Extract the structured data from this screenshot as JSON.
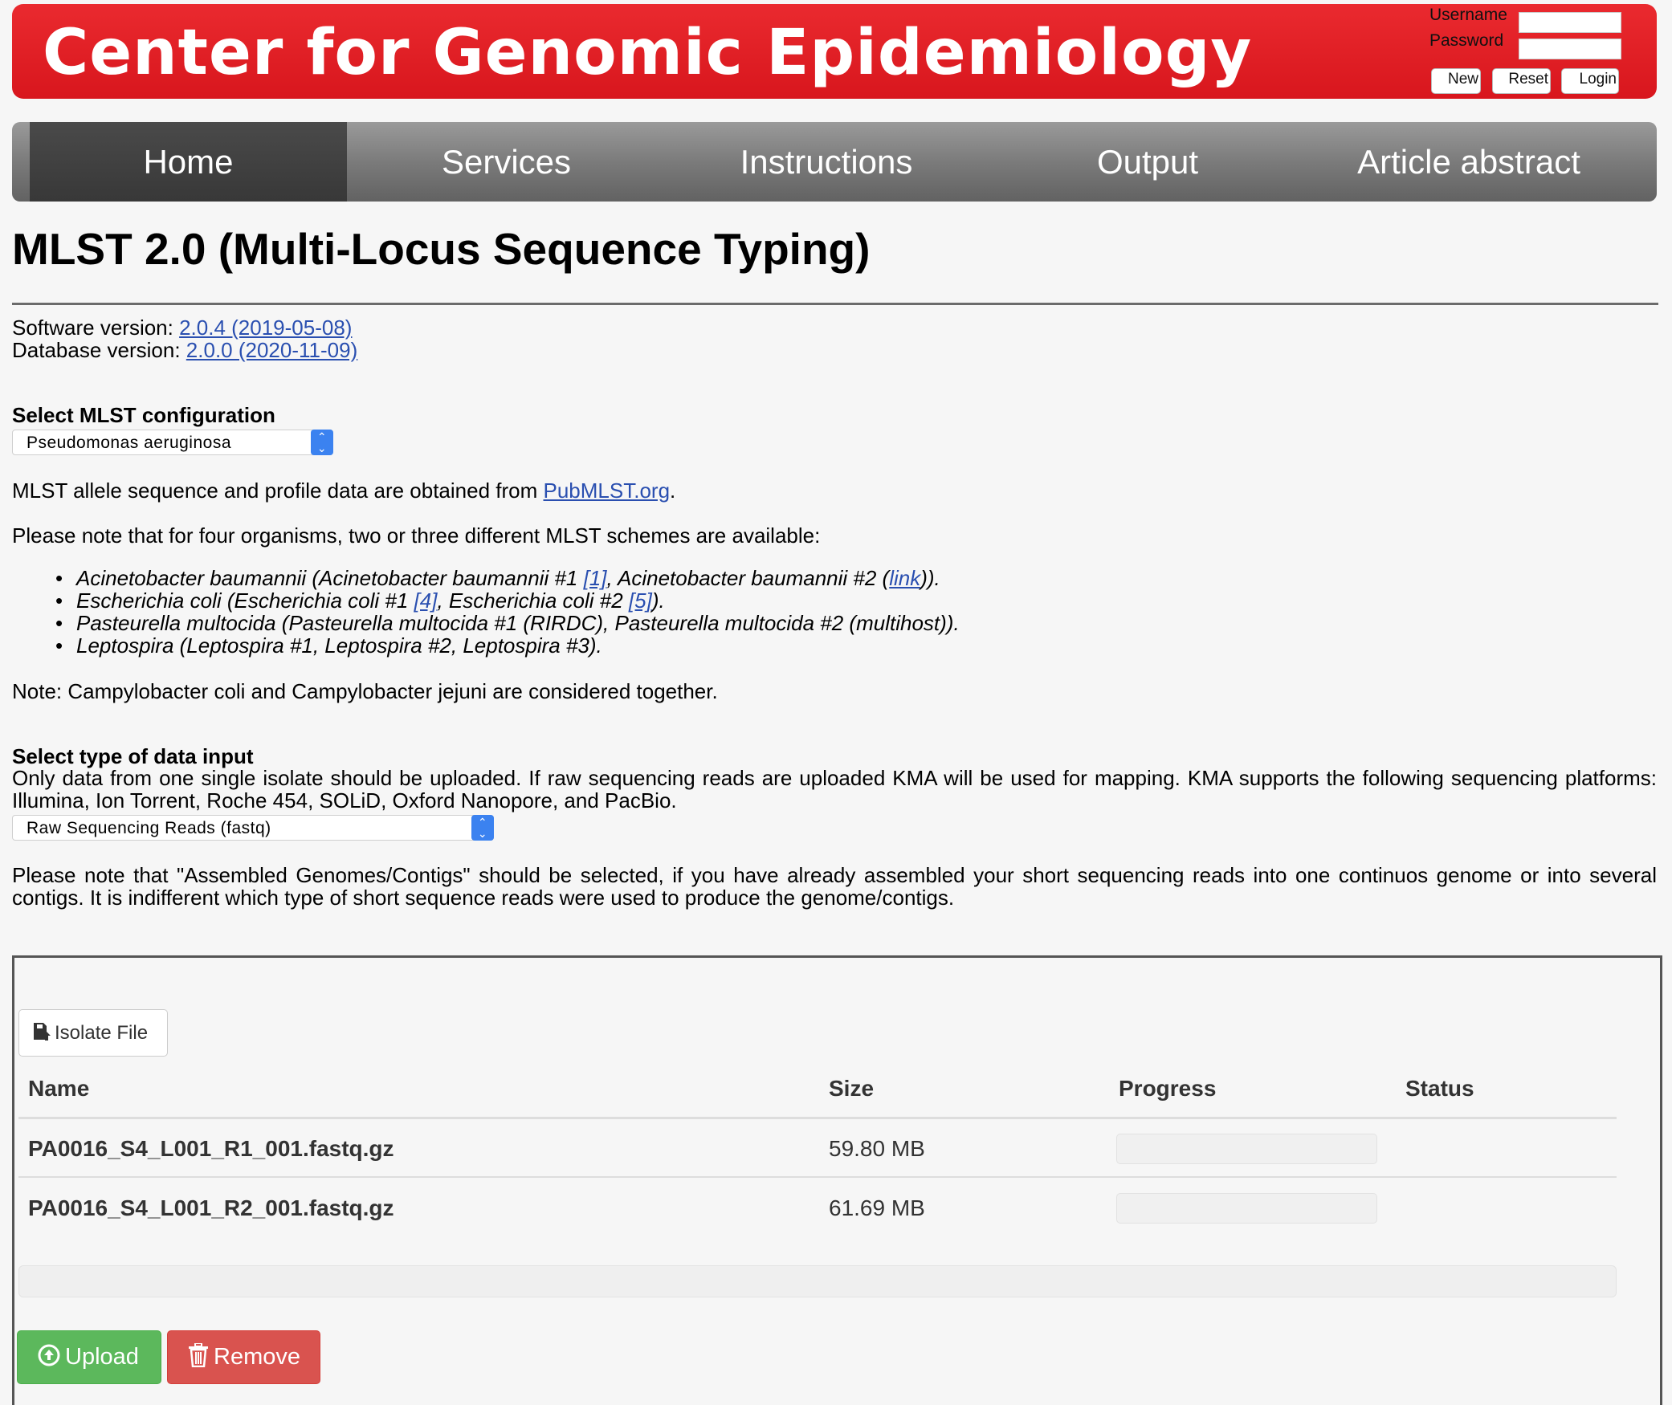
{
  "header": {
    "title": "Center for Genomic Epidemiology",
    "login": {
      "username_label": "Username",
      "password_label": "Password",
      "new_button": "New",
      "reset_button": "Reset",
      "login_button": "Login"
    }
  },
  "nav": {
    "items": [
      {
        "label": "Home",
        "active": true
      },
      {
        "label": "Services"
      },
      {
        "label": "Instructions"
      },
      {
        "label": "Output"
      },
      {
        "label": "Article abstract"
      }
    ]
  },
  "page": {
    "title": "MLST 2.0 (Multi-Locus Sequence Typing)",
    "software_label": "Software version: ",
    "software_version": "2.0.4 (2019-05-08)",
    "database_label": "Database version: ",
    "database_version": "2.0.0 (2020-11-09)"
  },
  "config": {
    "heading": "Select MLST configuration",
    "selected": "Pseudomonas aeruginosa",
    "source_text": "MLST allele sequence and profile data are obtained from ",
    "source_link": "PubMLST.org",
    "source_end": ".",
    "schemes_note": "Please note that for four organisms, two or three different MLST schemes are available:",
    "schemes": {
      "acinetobacter": {
        "a": "Acinetobacter baumannii (Acinetobacter baumannii #1 ",
        "link1": "[1]",
        "b": ", Acinetobacter baumannii #2 (",
        "link2": "link",
        "c": "))."
      },
      "ecoli": {
        "a": "Escherichia coli (Escherichia coli #1 ",
        "link1": "[4]",
        "b": ", Escherichia coli #2 ",
        "link2": "[5]",
        "c": ")."
      },
      "pasteurella": "Pasteurella multocida (Pasteurella multocida #1 (RIRDC), Pasteurella multocida #2 (multihost)).",
      "leptospira": "Leptospira (Leptospira #1, Leptospira #2, Leptospira #3)."
    },
    "campylobacter_note": "Note: Campylobacter coli and Campylobacter jejuni are considered together."
  },
  "input": {
    "heading": "Select type of data input",
    "description": "Only data from one single isolate should be uploaded. If raw sequencing reads are uploaded KMA will be used for mapping. KMA supports the following sequencing platforms: Illumina, Ion Torrent, Roche 454, SOLiD, Oxford Nanopore, and PacBio.",
    "selected": "Raw Sequencing Reads (fastq)",
    "assembled_note": "Please note that \"Assembled Genomes/Contigs\" should be selected, if you have already assembled your short sequencing reads into one continuos genome or into several contigs. It is indifferent which type of short sequence reads were used to produce the genome/contigs."
  },
  "upload": {
    "file_button": "Isolate File",
    "columns": [
      "Name",
      "Size",
      "Progress",
      "Status"
    ],
    "files": [
      {
        "name": "PA0016_S4_L001_R1_001.fastq.gz",
        "size": "59.80 MB",
        "progress": 0
      },
      {
        "name": "PA0016_S4_L001_R2_001.fastq.gz",
        "size": "61.69 MB",
        "progress": 0
      }
    ],
    "upload_button": "Upload",
    "remove_button": "Remove"
  },
  "colors": {
    "header_red": "#e01e25",
    "nav_gray": "#7b7b7b",
    "link_blue": "#2a4fb0",
    "upload_green": "#5cb85c",
    "remove_red": "#d9534f"
  }
}
